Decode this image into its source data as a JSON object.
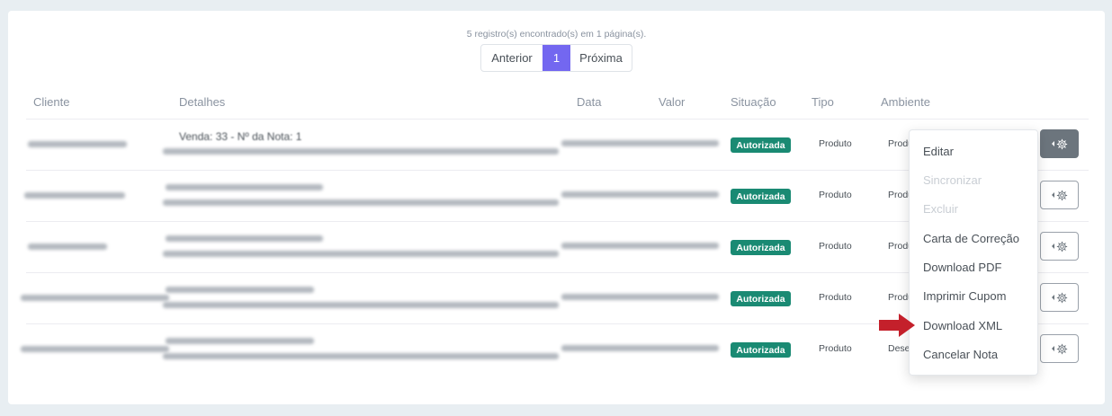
{
  "summary": "5 registro(s) encontrado(s) em 1 página(s).",
  "pagination": {
    "prev": "Anterior",
    "current": "1",
    "next": "Próxima"
  },
  "columns": {
    "cliente": "Cliente",
    "detalhes": "Detalhes",
    "data": "Data",
    "valor": "Valor",
    "situacao": "Situação",
    "tipo": "Tipo",
    "ambiente": "Ambiente"
  },
  "rows": [
    {
      "detalhes": "Venda: 33 - Nº da Nota: 1",
      "situacao": "Autorizada",
      "tipo": "Produto",
      "ambiente": "Produção"
    },
    {
      "situacao": "Autorizada",
      "tipo": "Produto",
      "ambiente": "Produção"
    },
    {
      "situacao": "Autorizada",
      "tipo": "Produto",
      "ambiente": "Produção"
    },
    {
      "situacao": "Autorizada",
      "tipo": "Produto",
      "ambiente": "Produção"
    },
    {
      "situacao": "Autorizada",
      "tipo": "Produto",
      "ambiente": "Desenvolvimento"
    }
  ],
  "menu": {
    "editar": "Editar",
    "sincronizar": "Sincronizar",
    "excluir": "Excluir",
    "carta": "Carta de Correção",
    "pdf": "Download PDF",
    "cupom": "Imprimir Cupom",
    "xml": "Download XML",
    "cancelar": "Cancelar Nota"
  },
  "colors": {
    "accent": "#7367f0",
    "success": "#1a8a73",
    "arrow": "#c4202b"
  }
}
